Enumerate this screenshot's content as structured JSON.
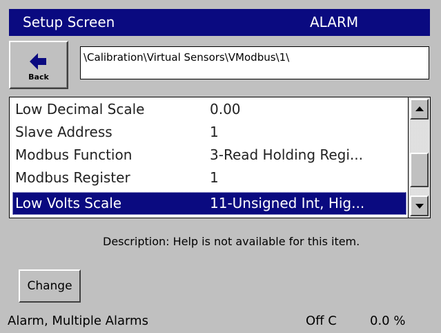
{
  "titlebar": {
    "title": "Setup Screen",
    "status": "ALARM"
  },
  "back_button": {
    "label": "Back",
    "icon": "arrow-left-icon"
  },
  "path": "\\Calibration\\Virtual Sensors\\VModbus\\1\\",
  "list": {
    "rows": [
      {
        "label": "Low Decimal Scale",
        "value": "0.00"
      },
      {
        "label": "Slave Address",
        "value": "1"
      },
      {
        "label": "Modbus Function",
        "value": "3-Read Holding Regi..."
      },
      {
        "label": "Modbus Register",
        "value": "1"
      },
      {
        "label": "Low Volts Scale",
        "value": "11-Unsigned Int, Hig..."
      }
    ],
    "selected_index": 4
  },
  "description": "Description:  Help is not available for this item.",
  "change_button": {
    "label": "Change"
  },
  "statusbar": {
    "alarm": "Alarm, Multiple Alarms",
    "temp": "Off C",
    "percent": "0.0 %"
  },
  "colors": {
    "titlebar": "#0a0a80",
    "selection": "#0a0a80",
    "background": "#c0c0c0"
  }
}
